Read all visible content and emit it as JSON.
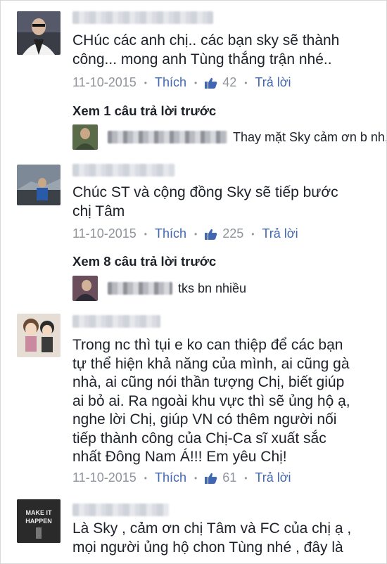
{
  "comments": [
    {
      "text": "CHúc các anh chị.. các bạn sky sẽ thành\ncông... mong anh Tùng thắng trận nhé..",
      "date": "11-10-2015",
      "like_label": "Thích",
      "like_count": "42",
      "reply_label": "Trả lời",
      "view_previous": "Xem 1 câu trả lời trước",
      "reply_preview": "Thay mặt Sky cảm ơn b nh..."
    },
    {
      "text": "Chúc ST và cộng đồng Sky sẽ tiếp bước\nchị Tâm",
      "date": "11-10-2015",
      "like_label": "Thích",
      "like_count": "225",
      "reply_label": "Trả lời",
      "view_previous": "Xem 8 câu trả lời trước",
      "reply_preview": "tks bn nhiều"
    },
    {
      "text": "Trong nc thì tụi e ko can thiệp để các bạn\ntự thể hiện khả năng của mình, ai cũng gà\nnhà, ai cũng nói thần tượng Chị, biết giúp\nai bỏ ai. Ra ngoài khu vực thì sẽ ủng hộ ạ,\nnghe lời Chị, giúp VN có thêm người nối\ntiếp thành công của Chị-Ca sĩ xuất sắc\nnhất Đông Nam Á!!! Em yêu Chị!",
      "date": "11-10-2015",
      "like_label": "Thích",
      "like_count": "61",
      "reply_label": "Trả lời"
    },
    {
      "text": "Là Sky , cảm ơn chị Tâm và FC của chị ạ ,\nmọi người ủng hộ chon Tùng nhé , đây là",
      "avatar_text": "MAKE IT HAPPEN"
    }
  ],
  "colors": {
    "link": "#4267b2",
    "meta": "#90949c",
    "text": "#1d2129"
  },
  "icons": {
    "like": "thumbs-up-icon"
  }
}
